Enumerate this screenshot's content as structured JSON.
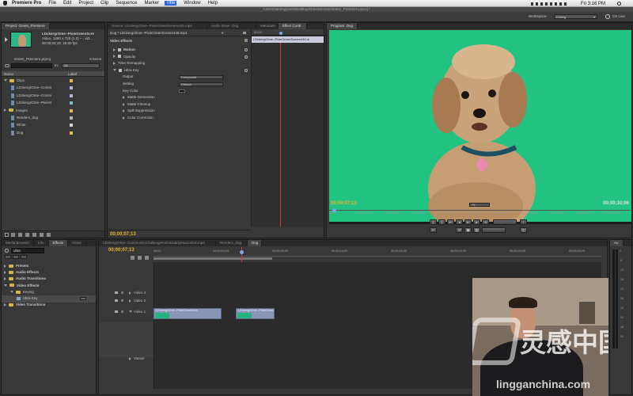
{
  "menubar": {
    "apple": "",
    "app": "Premiere Pro",
    "items": [
      "File",
      "Edit",
      "Project",
      "Clip",
      "Sequence",
      "Marker",
      "Title",
      "Window",
      "Help"
    ],
    "time": "Fri 3:16 PM"
  },
  "titlebar": {
    "path": "/Users/sammyjones/Desktop/GreenScreen/Green_Premiere.prproj *"
  },
  "workspace": {
    "label": "Workspace:",
    "value": "Editing",
    "cslive": "CS Live"
  },
  "project": {
    "tab": "Project: Green_Premiere",
    "clip_name": "LDckergrOme--PixieGreenScre",
    "clip_info1": "Video, 1280 x 720 (1.0) – , vid...",
    "clip_info2": "00;00;04;19, 30.00 fps",
    "file": "Green_Premiere.prproj",
    "items_count": "8 Items",
    "in_label": "In:",
    "in_value": "All",
    "col_name": "Name",
    "col_label": "Label",
    "items": [
      {
        "name": "Clips",
        "kind": "folder",
        "open": true,
        "color": "#e2bb4c"
      },
      {
        "name": "LDckergrOme--Comm",
        "kind": "clip",
        "color": "#b0b6dc"
      },
      {
        "name": "LDckergrOme--Comm",
        "kind": "clip",
        "color": "#b0b6dc"
      },
      {
        "name": "LDckergrOme--PixieG",
        "kind": "clip",
        "color": "#7fb9c2"
      },
      {
        "name": "Images",
        "kind": "folder",
        "color": "#e2bb4c"
      },
      {
        "name": "Renders_dog",
        "kind": "file",
        "color": "#b7b7b7"
      },
      {
        "name": "White",
        "kind": "file",
        "color": "#d5d5d5"
      },
      {
        "name": "Dog",
        "kind": "file",
        "color": "#e2bb4c"
      }
    ]
  },
  "effect_controls": {
    "tabs": [
      "Source: LDckergrOme--PixieGreenScreen446.mp4",
      "Audio Mixer: Dog",
      "Metadata",
      "Effect Contr"
    ],
    "header": "Dog * LDckergrOme--PixieGreenScreen446.mp4",
    "clip_chip": "LDckergrOme--PixieGreenScreen446.m",
    "ruler_tc": "00;00",
    "video_effects": "Video Effects",
    "rows": [
      {
        "label": "Motion",
        "level": 1,
        "fx": true
      },
      {
        "label": "Opacity",
        "level": 1,
        "fx": true
      },
      {
        "label": "Time Remapping",
        "level": 1
      },
      {
        "label": "Ultra Key",
        "level": 1,
        "fx": true,
        "open": true
      },
      {
        "label": "Output",
        "level": 2,
        "value": "Composite"
      },
      {
        "label": "Setting",
        "level": 2,
        "value": "Default"
      },
      {
        "label": "Key Color",
        "level": 2
      },
      {
        "label": "Matte Generation",
        "level": 2
      },
      {
        "label": "Matte Cleanup",
        "level": 2
      },
      {
        "label": "Spill Suppression",
        "level": 2
      },
      {
        "label": "Color Correction",
        "level": 2
      }
    ],
    "timecode": "00;00;07;13"
  },
  "program": {
    "tab": "Program: Dog",
    "timecode_left": "00;00;07;13",
    "fit": "Fit",
    "timecode_right": "00;00;10;06",
    "ruler": [
      "00;00",
      "00;00;19;29",
      "00;01;59;28",
      "00;02;59;28",
      "00;03;59;28",
      "00;04;59;29",
      "00;05;59;28",
      "00;06;59;29",
      "00;07;59;28",
      "00;08;59;29",
      "00;09;59;28"
    ],
    "screen_color": "#22c283"
  },
  "effects_panel": {
    "tabs": [
      "Media Browser",
      "Info",
      "Effects",
      "Histor"
    ],
    "search": "ultra",
    "items": [
      {
        "label": "Presets",
        "level": 0,
        "kind": "folder"
      },
      {
        "label": "Audio Effects",
        "level": 0,
        "kind": "folder"
      },
      {
        "label": "Audio Transitions",
        "level": 0,
        "kind": "folder"
      },
      {
        "label": "Video Effects",
        "level": 0,
        "kind": "folder",
        "open": true
      },
      {
        "label": "Keying",
        "level": 1,
        "kind": "folder",
        "open": true
      },
      {
        "label": "Ultra Key",
        "level": 2,
        "kind": "effect"
      },
      {
        "label": "Video Transitions",
        "level": 0,
        "kind": "folder"
      }
    ]
  },
  "timeline": {
    "tabs": [
      "LDckergrOme--CommunityChallenge#4GoDaddyMusic4DICmp4",
      "Renders_dog",
      "Dog"
    ],
    "timecode": "00;00;07;13",
    "ruler": [
      "00;00",
      "00;00;04;29",
      "00;00;09;29",
      "00;00;14;29",
      "00;00;19;29",
      "00;00;24;29",
      "00;00;29;29",
      "00;00;34;29"
    ],
    "tracks": [
      "Video 3",
      "Video 2",
      "Video 1",
      "Audio 1",
      "Audio 2",
      "Audio 3",
      "Master"
    ],
    "clips": [
      {
        "label": "LDckergrOme--PixieGreenScre",
        "start": 0.0,
        "end": 0.56
      },
      {
        "label": "LDckergrOme--PixieGreenScre",
        "start": 0.68,
        "end": 1.0
      }
    ]
  },
  "audio_meter": {
    "label": "Au",
    "scale": [
      "0",
      "-6",
      "-12",
      "-18",
      "-24",
      "-30",
      "-36",
      "-42",
      "-48",
      "-54"
    ]
  },
  "watermark": {
    "cn": "灵感中国",
    "url": "lingganchina.com"
  }
}
